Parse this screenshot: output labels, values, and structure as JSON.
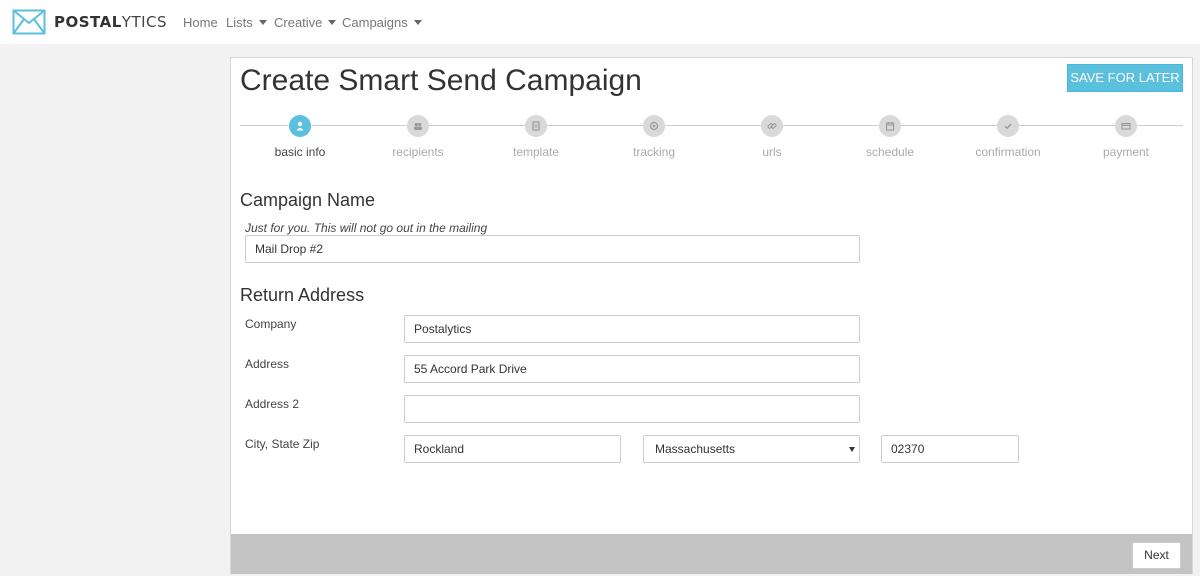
{
  "app": {
    "brand_bold": "POSTAL",
    "brand_light": "YTICS"
  },
  "nav": {
    "home": "Home",
    "lists": "Lists",
    "creative": "Creative",
    "campaigns": "Campaigns"
  },
  "page": {
    "title": "Create Smart Send Campaign",
    "save_label": "SAVE FOR LATER"
  },
  "steps": [
    {
      "label": "basic info",
      "icon": "user-icon",
      "active": true
    },
    {
      "label": "recipients",
      "icon": "users-icon",
      "active": false
    },
    {
      "label": "template",
      "icon": "document-icon",
      "active": false
    },
    {
      "label": "tracking",
      "icon": "target-icon",
      "active": false
    },
    {
      "label": "urls",
      "icon": "link-icon",
      "active": false
    },
    {
      "label": "schedule",
      "icon": "calendar-icon",
      "active": false
    },
    {
      "label": "confirmation",
      "icon": "check-icon",
      "active": false
    },
    {
      "label": "payment",
      "icon": "credit-card-icon",
      "active": false
    }
  ],
  "campaign": {
    "section_title": "Campaign Name",
    "hint": "Just for you. This will not go out in the mailing",
    "name_value": "Mail Drop #2"
  },
  "return_address": {
    "section_title": "Return Address",
    "company_label": "Company",
    "company_value": "Postalytics",
    "address_label": "Address",
    "address_value": "55 Accord Park Drive",
    "address2_label": "Address 2",
    "address2_value": "",
    "city_state_zip_label": "City, State Zip",
    "city_value": "Rockland",
    "state_value": "Massachusetts",
    "zip_value": "02370"
  },
  "footer": {
    "next_label": "Next"
  },
  "colors": {
    "accent": "#5bc0de",
    "inactive_step": "#d9d9d9",
    "footer_bg": "#c4c4c4",
    "page_bg": "#f2f2f2"
  }
}
